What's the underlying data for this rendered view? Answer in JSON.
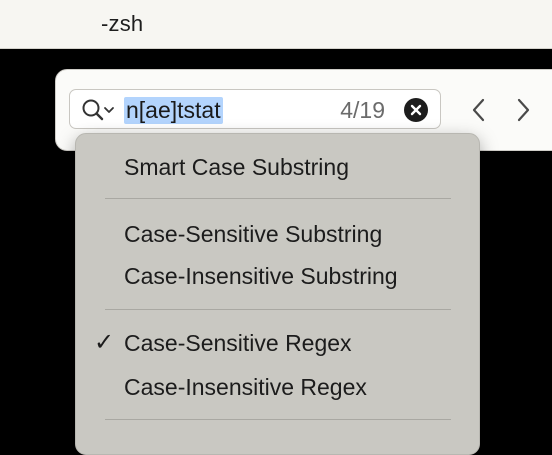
{
  "window": {
    "title": "-zsh"
  },
  "find_bar": {
    "mode_icon": "magnifier-with-chevron",
    "query": "n[ae]tstat",
    "match_count": "4/19",
    "clear_icon": "clear-x-circle",
    "prev_icon": "chevron-left",
    "next_icon": "chevron-right"
  },
  "search_mode_menu": {
    "items": [
      {
        "label": "Smart Case Substring",
        "checked": false
      },
      {
        "label": "Case-Sensitive Substring",
        "checked": false
      },
      {
        "label": "Case-Insensitive Substring",
        "checked": false
      },
      {
        "label": "Case-Sensitive Regex",
        "checked": true
      },
      {
        "label": "Case-Insensitive Regex",
        "checked": false
      }
    ],
    "check_mark": "✓"
  },
  "colors": {
    "selection_highlight": "#b3d4fd",
    "menu_background": "#c9c8c2",
    "terminal_background": "#000000"
  }
}
